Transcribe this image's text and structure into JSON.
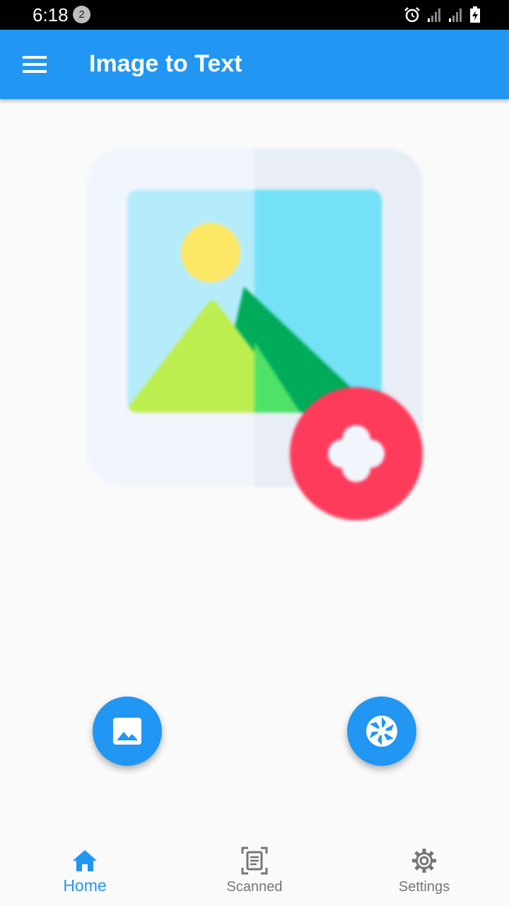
{
  "status_bar": {
    "time": "6:18",
    "notification_count": "2",
    "icons": [
      "alarm-icon",
      "signal-icon",
      "signal-icon",
      "battery-charging-icon"
    ]
  },
  "app_bar": {
    "title": "Image to Text",
    "menu_icon": "menu-icon"
  },
  "hero": {
    "icon": "add-image-illustration"
  },
  "actions": {
    "gallery_icon": "image-icon",
    "camera_icon": "camera-aperture-icon"
  },
  "bottom_nav": {
    "items": [
      {
        "label": "Home",
        "icon": "home-icon",
        "active": true
      },
      {
        "label": "Scanned",
        "icon": "document-scan-icon",
        "active": false
      },
      {
        "label": "Settings",
        "icon": "gear-icon",
        "active": false
      }
    ]
  },
  "colors": {
    "primary": "#2196f3",
    "accent_red": "#ff3b5c",
    "background": "#fafafa",
    "inactive": "#757575"
  }
}
